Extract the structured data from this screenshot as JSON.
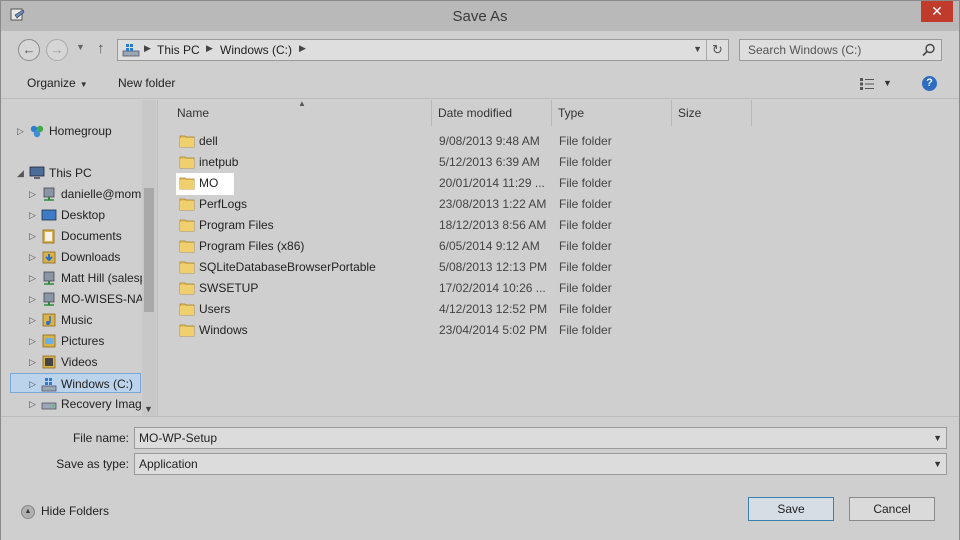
{
  "window": {
    "title": "Save As",
    "close_glyph": "✕"
  },
  "address": {
    "crumbs": [
      "This PC",
      "Windows (C:)"
    ],
    "search_placeholder": "Search Windows (C:)"
  },
  "toolbar": {
    "organize": "Organize",
    "new_folder": "New folder"
  },
  "nav": {
    "items": [
      {
        "label": "Homegroup",
        "icon": "homegroup-icon"
      },
      {
        "label": "This PC",
        "icon": "computer-icon"
      },
      {
        "label": "danielle@mom",
        "icon": "network-drive-icon"
      },
      {
        "label": "Desktop",
        "icon": "folder-icon"
      },
      {
        "label": "Documents",
        "icon": "documents-icon"
      },
      {
        "label": "Downloads",
        "icon": "downloads-icon"
      },
      {
        "label": "Matt Hill (salesp",
        "icon": "network-drive-icon"
      },
      {
        "label": "MO-WISES-NA",
        "icon": "network-drive-icon"
      },
      {
        "label": "Music",
        "icon": "music-icon"
      },
      {
        "label": "Pictures",
        "icon": "pictures-icon"
      },
      {
        "label": "Videos",
        "icon": "videos-icon"
      },
      {
        "label": "Windows (C:)",
        "icon": "drive-icon"
      },
      {
        "label": "Recovery Image",
        "icon": "drive-icon"
      }
    ]
  },
  "columns": {
    "name": "Name",
    "date": "Date modified",
    "type": "Type",
    "size": "Size"
  },
  "files": [
    {
      "name": "dell",
      "date": "9/08/2013 9:48 AM",
      "type": "File folder"
    },
    {
      "name": "inetpub",
      "date": "5/12/2013 6:39 AM",
      "type": "File folder"
    },
    {
      "name": "MO",
      "date": "20/01/2014 11:29 ...",
      "type": "File folder"
    },
    {
      "name": "PerfLogs",
      "date": "23/08/2013 1:22 AM",
      "type": "File folder"
    },
    {
      "name": "Program Files",
      "date": "18/12/2013 8:56 AM",
      "type": "File folder"
    },
    {
      "name": "Program Files (x86)",
      "date": "6/05/2014 9:12 AM",
      "type": "File folder"
    },
    {
      "name": "SQLiteDatabaseBrowserPortable",
      "date": "5/08/2013 12:13 PM",
      "type": "File folder"
    },
    {
      "name": "SWSETUP",
      "date": "17/02/2014 10:26 ...",
      "type": "File folder"
    },
    {
      "name": "Users",
      "date": "4/12/2013 12:52 PM",
      "type": "File folder"
    },
    {
      "name": "Windows",
      "date": "23/04/2014 5:02 PM",
      "type": "File folder"
    }
  ],
  "form": {
    "file_name_label": "File name:",
    "file_name_value": "MO-WP-Setup",
    "save_type_label": "Save as type:",
    "save_type_value": "Application"
  },
  "footer": {
    "hide_folders": "Hide Folders",
    "save": "Save",
    "cancel": "Cancel"
  }
}
